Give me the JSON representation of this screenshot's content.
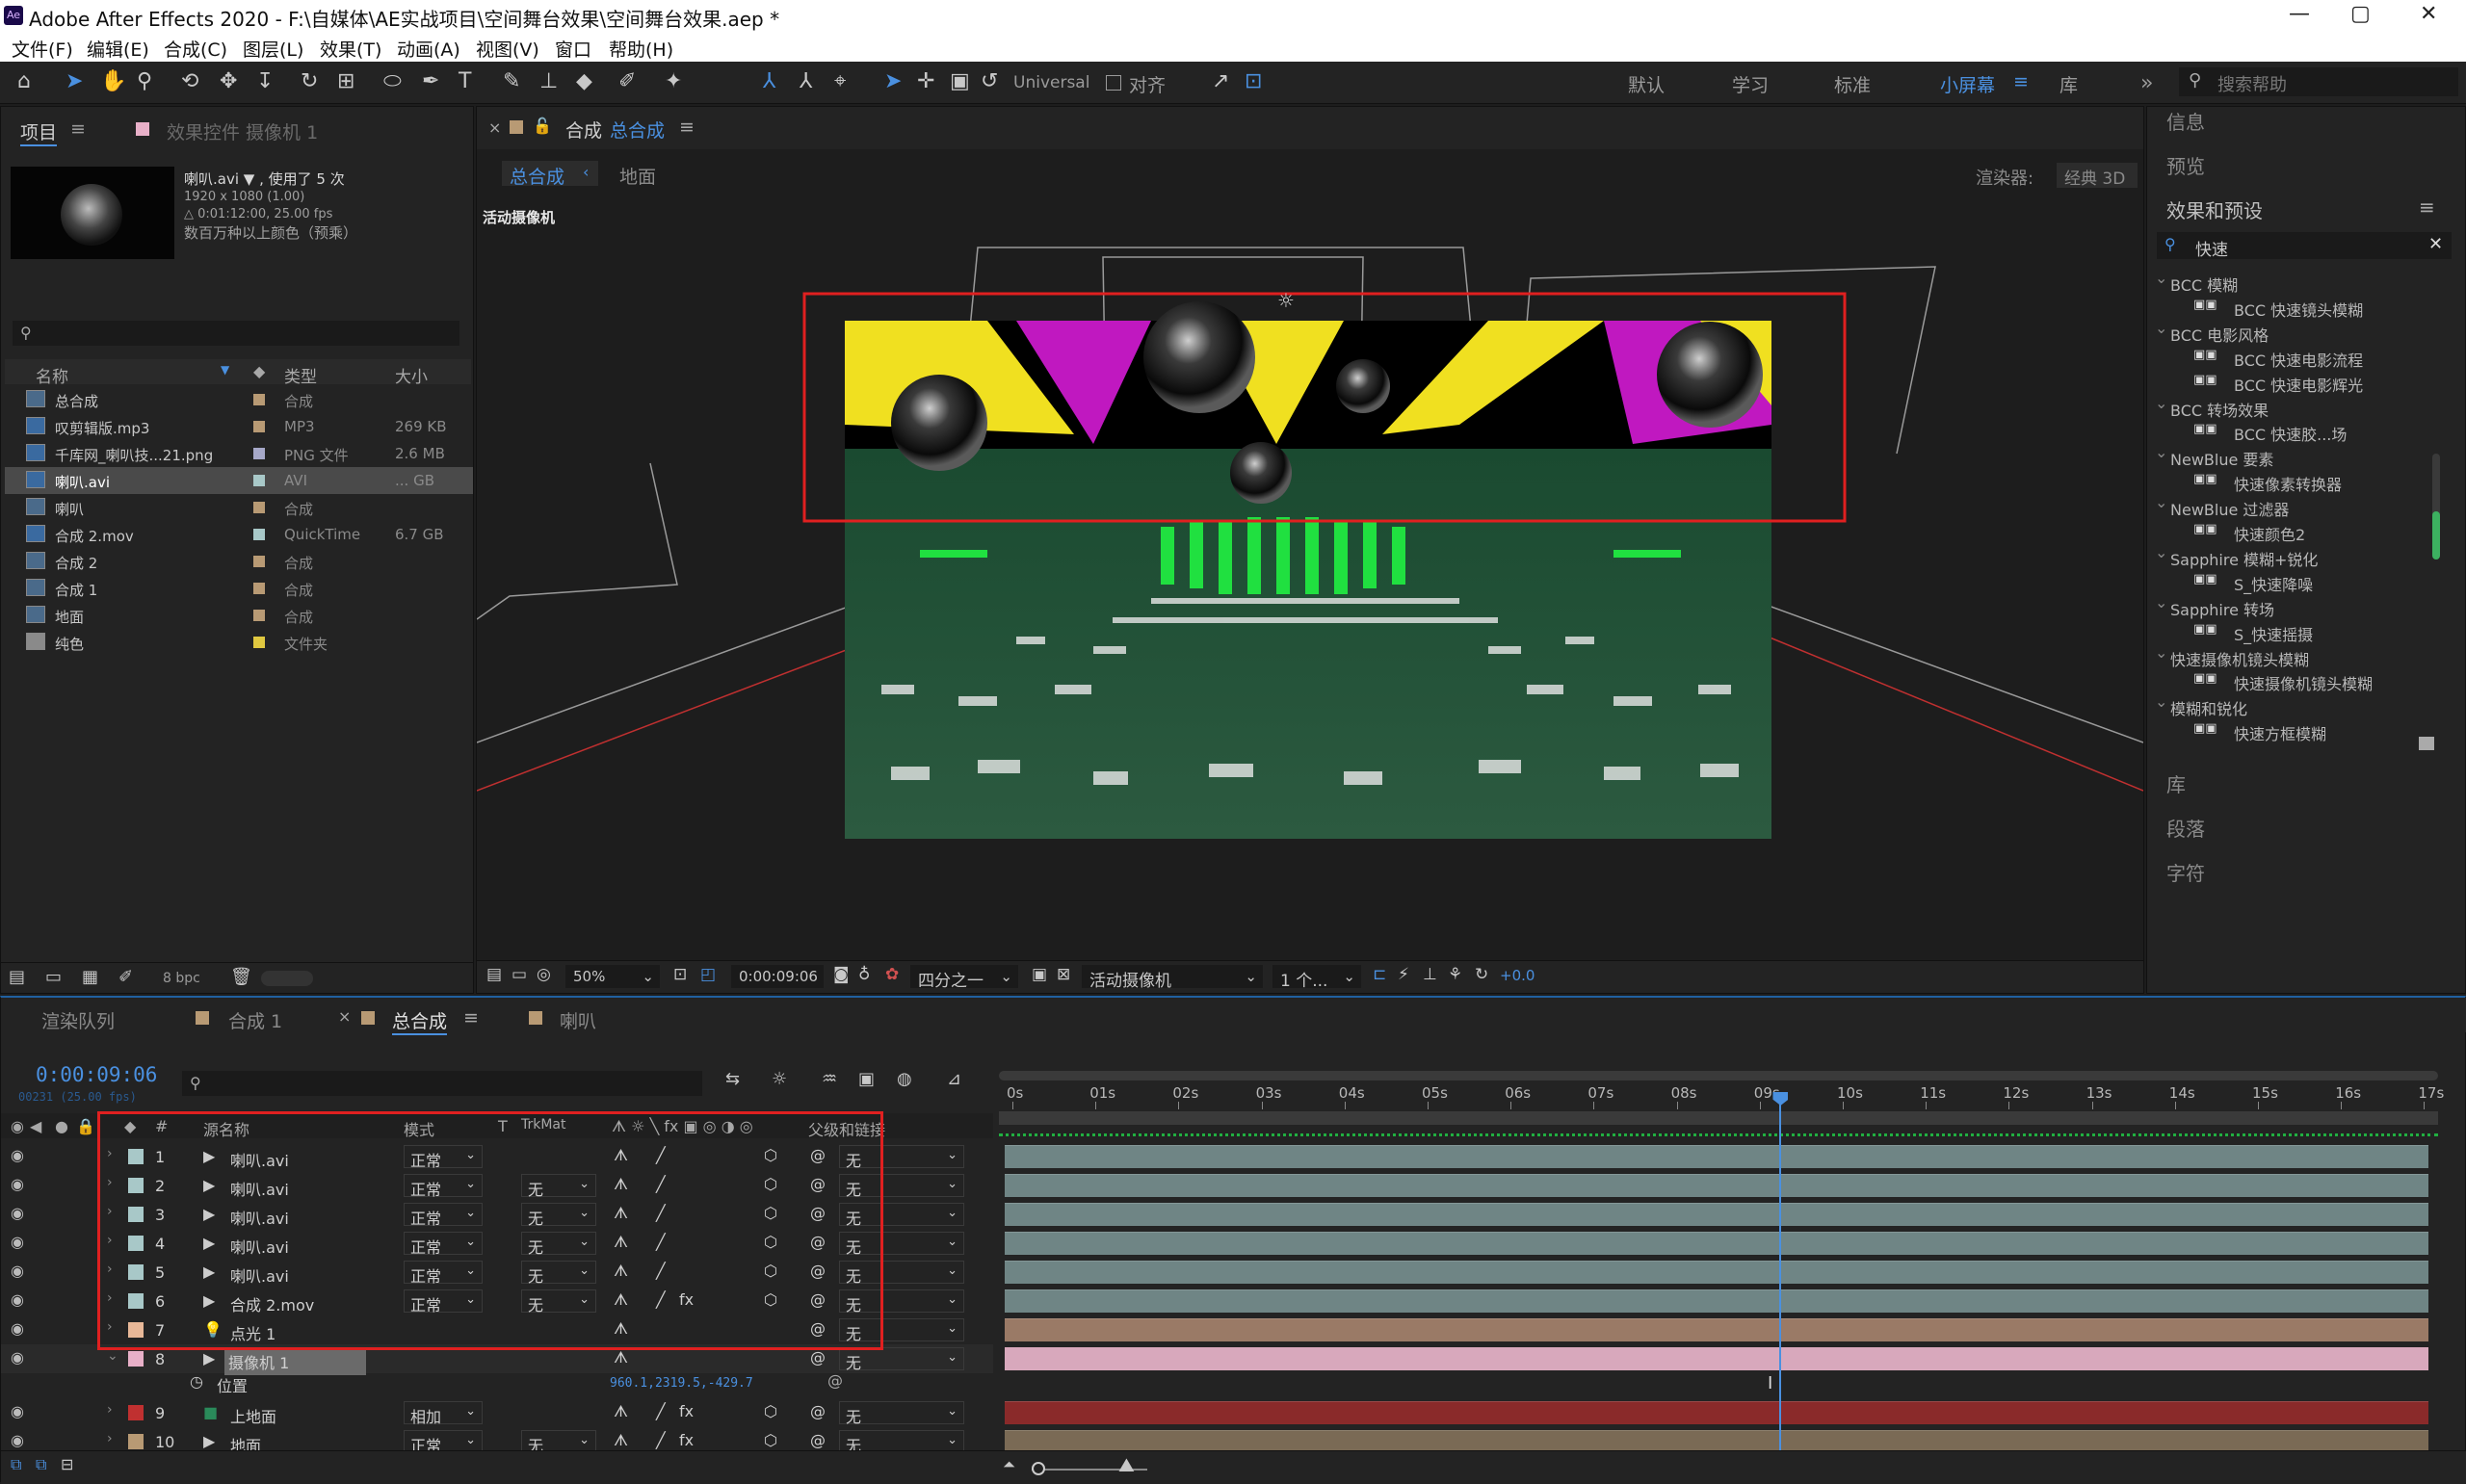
{
  "window": {
    "title": "Adobe After Effects 2020 - F:\\自媒体\\AE实战项目\\空间舞台效果\\空间舞台效果.aep *",
    "app_icon": "Ae",
    "min": "—",
    "max": "▢",
    "close": "✕"
  },
  "menu": [
    "文件(F)",
    "编辑(E)",
    "合成(C)",
    "图层(L)",
    "效果(T)",
    "动画(A)",
    "视图(V)",
    "窗口",
    "帮助(H)"
  ],
  "toolbar": {
    "axis_mode": "Universal",
    "snap_label": "对齐",
    "workspaces": [
      "默认",
      "学习",
      "标准",
      "小屏幕",
      "库"
    ],
    "active_workspace": "小屏幕",
    "search_placeholder": "搜索帮助"
  },
  "project_panel": {
    "tab_project": "项目",
    "tab_effect_controls": "效果控件 摄像机 1",
    "asset_name": "喇叭.avi ▼ , 使用了 5 次",
    "asset_res": "1920 x 1080 (1.00)",
    "asset_dur": "△ 0:01:12:00, 25.00 fps",
    "asset_color": "数百万种以上颜色（预乘）",
    "columns": {
      "name": "名称",
      "type": "类型",
      "size": "大小"
    },
    "items": [
      {
        "name": "总合成",
        "type": "合成",
        "size": "",
        "label": "#b89a74"
      },
      {
        "name": "叹剪辑版.mp3",
        "type": "MP3",
        "size": "269 KB",
        "label": "#b89a74"
      },
      {
        "name": "千库网_喇叭技...21.png",
        "type": "PNG 文件",
        "size": "2.6 MB",
        "label": "#a6a8c8"
      },
      {
        "name": "喇叭.avi",
        "type": "AVI",
        "size": "... GB",
        "label": "#a8c8c8"
      },
      {
        "name": "喇叭",
        "type": "合成",
        "size": "",
        "label": "#b89a74"
      },
      {
        "name": "合成 2.mov",
        "type": "QuickTime",
        "size": "6.7 GB",
        "label": "#a8c8c8"
      },
      {
        "name": "合成 2",
        "type": "合成",
        "size": "",
        "label": "#b89a74"
      },
      {
        "name": "合成 1",
        "type": "合成",
        "size": "",
        "label": "#b89a74"
      },
      {
        "name": "地面",
        "type": "合成",
        "size": "",
        "label": "#b89a74"
      },
      {
        "name": "纯色",
        "type": "文件夹",
        "size": "",
        "label": "#e0c840"
      }
    ],
    "bpc": "8 bpc"
  },
  "comp_panel": {
    "tab": "合成 总合成",
    "tab_prefix": "合成",
    "tab_name": "总合成",
    "breadcrumb": [
      "总合成",
      "地面"
    ],
    "renderer_label": "渲染器:",
    "renderer": "经典 3D",
    "view_label": "活动摄像机",
    "zoom": "50%",
    "timecode": "0:00:09:06",
    "resolution": "四分之一",
    "camera": "活动摄像机",
    "views": "1 个...",
    "exposure": "+0.0"
  },
  "right_panel": {
    "info": "信息",
    "preview": "预览",
    "effects_title": "效果和预设",
    "search": "快速",
    "tree": [
      {
        "t": "BCC 模糊",
        "lvl": 0
      },
      {
        "t": "BCC 快速镜头模糊",
        "lvl": 1
      },
      {
        "t": "BCC 电影风格",
        "lvl": 0
      },
      {
        "t": "BCC 快速电影流程",
        "lvl": 1
      },
      {
        "t": "BCC 快速电影辉光",
        "lvl": 1
      },
      {
        "t": "BCC 转场效果",
        "lvl": 0
      },
      {
        "t": "BCC 快速胶...场",
        "lvl": 1
      },
      {
        "t": "NewBlue 要素",
        "lvl": 0
      },
      {
        "t": "快速像素转换器",
        "lvl": 1
      },
      {
        "t": "NewBlue 过滤器",
        "lvl": 0
      },
      {
        "t": "快速颜色2",
        "lvl": 1
      },
      {
        "t": "Sapphire 模糊+锐化",
        "lvl": 0
      },
      {
        "t": "S_快速降噪",
        "lvl": 1
      },
      {
        "t": "Sapphire 转场",
        "lvl": 0
      },
      {
        "t": "S_快速摇摄",
        "lvl": 1
      },
      {
        "t": "快速摄像机镜头模糊",
        "lvl": 0
      },
      {
        "t": "快速摄像机镜头模糊",
        "lvl": 1
      },
      {
        "t": "模糊和锐化",
        "lvl": 0
      },
      {
        "t": "快速方框模糊",
        "lvl": 1
      }
    ],
    "library": "库",
    "paragraph": "段落",
    "character": "字符"
  },
  "timeline": {
    "tabs": [
      "渲染队列",
      "合成 1",
      "总合成",
      "喇叭"
    ],
    "timecode": "0:00:09:06",
    "frame_info": "00231 (25.00 fps)",
    "headers": {
      "num": "#",
      "source": "源名称",
      "mode": "模式",
      "t": "T",
      "trkmat": "TrkMat",
      "parent": "父级和链接"
    },
    "layers": [
      {
        "num": "1",
        "name": "喇叭.avi",
        "mode": "正常",
        "trk": "",
        "parent": "无",
        "color": "#a8c8c8",
        "bar": "#6f8585"
      },
      {
        "num": "2",
        "name": "喇叭.avi",
        "mode": "正常",
        "trk": "无",
        "parent": "无",
        "color": "#a8c8c8",
        "bar": "#6f8585"
      },
      {
        "num": "3",
        "name": "喇叭.avi",
        "mode": "正常",
        "trk": "无",
        "parent": "无",
        "color": "#a8c8c8",
        "bar": "#6f8585"
      },
      {
        "num": "4",
        "name": "喇叭.avi",
        "mode": "正常",
        "trk": "无",
        "parent": "无",
        "color": "#a8c8c8",
        "bar": "#6f8585"
      },
      {
        "num": "5",
        "name": "喇叭.avi",
        "mode": "正常",
        "trk": "无",
        "parent": "无",
        "color": "#a8c8c8",
        "bar": "#6f8585"
      },
      {
        "num": "6",
        "name": "合成 2.mov",
        "mode": "正常",
        "trk": "无",
        "parent": "无",
        "color": "#a8c8c8",
        "bar": "#6f8585"
      },
      {
        "num": "7",
        "name": "点光 1",
        "mode": "",
        "trk": "",
        "parent": "无",
        "color": "#e8b898",
        "bar": "#9a7a66"
      },
      {
        "num": "8",
        "name": "摄像机 1",
        "mode": "",
        "trk": "",
        "parent": "无",
        "color": "#e8b0c8",
        "bar": "#c890a8"
      },
      {
        "num": "9",
        "name": "上地面",
        "mode": "相加",
        "trk": "",
        "parent": "无",
        "color": "#c03030",
        "bar": "#8a2a2a"
      },
      {
        "num": "10",
        "name": "地面",
        "mode": "正常",
        "trk": "无",
        "parent": "无",
        "color": "#b89a74",
        "bar": "#7a6a55"
      }
    ],
    "position_label": "位置",
    "position_value": "960.1,2319.5,-429.7",
    "ruler": [
      "0s",
      "01s",
      "02s",
      "03s",
      "04s",
      "05s",
      "06s",
      "07s",
      "08s",
      "09s",
      "10s",
      "11s",
      "12s",
      "13s",
      "14s",
      "15s",
      "16s",
      "17s"
    ],
    "playhead_seconds": 9.24
  }
}
